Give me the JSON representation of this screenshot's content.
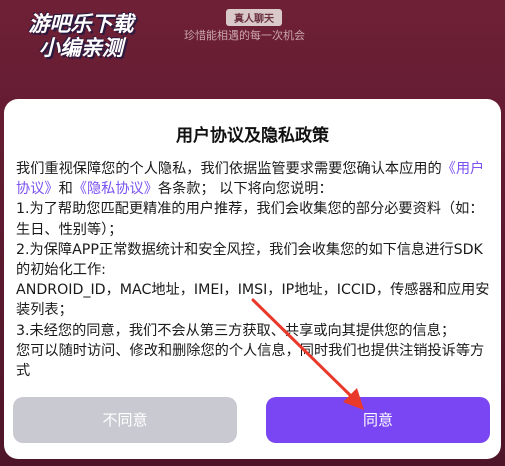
{
  "background": {
    "watermark_line1": "游吧乐下载",
    "watermark_line2": "小编亲测",
    "badge": "真人聊天",
    "subtitle": "珍惜能相遇的每一次机会"
  },
  "dialog": {
    "title": "用户协议及隐私政策",
    "intro_part1": "我们重视保障您的个人隐私，我们依据监管要求需要您确认本应用的",
    "link_user_agreement": "《用户协议》",
    "intro_and": "和",
    "link_privacy_agreement": "《隐私协议》",
    "intro_part2": "各条款；  以下将向您说明：",
    "item1": "1.为了帮助您匹配更精准的用户推荐，我们会收集您的部分必要资料（如：生日、性别等）；",
    "item2": "2.为保障APP正常数据统计和安全风控，我们会收集您的如下信息进行SDK的初始化工作:",
    "item2_detail": "ANDROID_ID，MAC地址，IMEI，IMSI，IP地址，ICCID，传感器和应用安装列表；",
    "item3": "3.未经您的同意，我们不会从第三方获取、共享或向其提供您的信息；",
    "closing": "您可以随时访问、修改和删除您的个人信息，同时我们也提供注销投诉等方式",
    "disagree_label": "不同意",
    "agree_label": "同意"
  },
  "colors": {
    "accent": "#7a46f4",
    "link": "#7b52f0",
    "disabled_button": "#c9c9d2",
    "annotation_arrow": "#e8392b",
    "backdrop": "#5e1a30"
  }
}
